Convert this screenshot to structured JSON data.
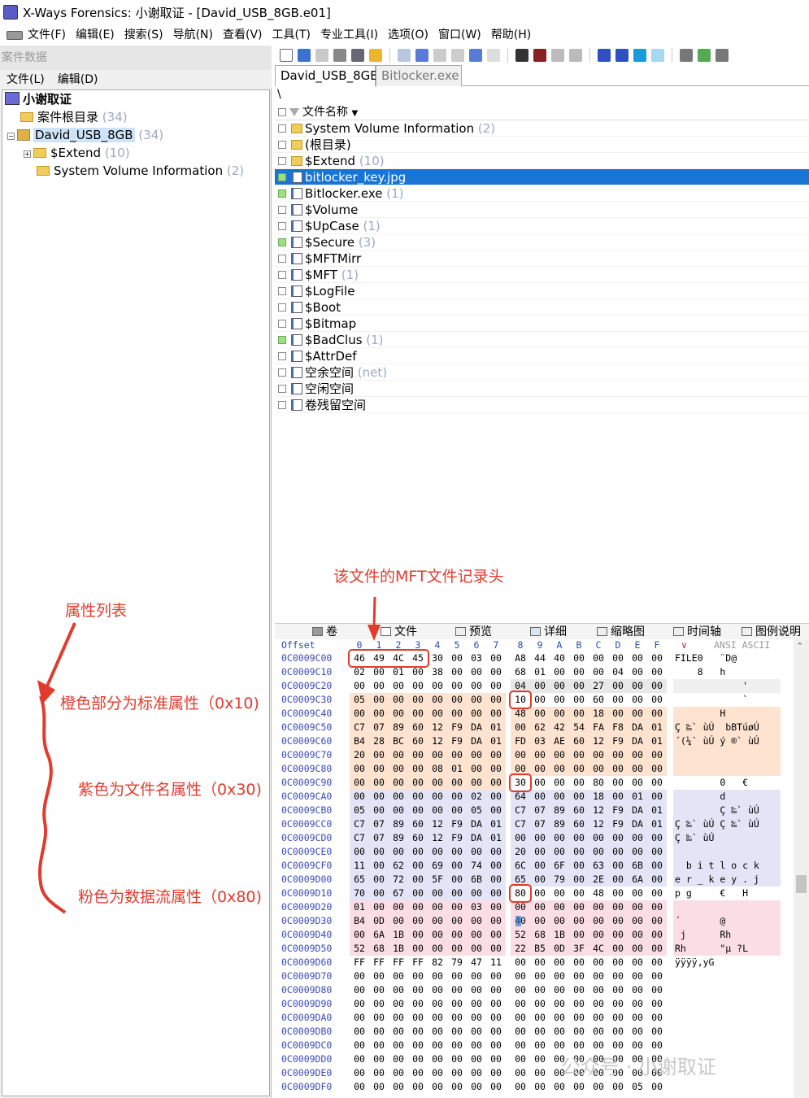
{
  "window": {
    "title": "X-Ways Forensics: 小谢取证 - [David_USB_8GB.e01]"
  },
  "menu": [
    "文件(F)",
    "编辑(E)",
    "搜索(S)",
    "导航(N)",
    "查看(V)",
    "工具(T)",
    "专业工具(I)",
    "选项(O)",
    "窗口(W)",
    "帮助(H)"
  ],
  "left": {
    "case_header": "案件数据",
    "menu": [
      "文件(L)",
      "编辑(D)"
    ],
    "tree": [
      {
        "label": "小谢取证",
        "count": ""
      },
      {
        "label": "案件根目录",
        "count": "(34)"
      },
      {
        "label": "David_USB_8GB",
        "count": "(34)"
      },
      {
        "label": "$Extend",
        "count": "(10)"
      },
      {
        "label": "System Volume Information",
        "count": "(2)"
      }
    ]
  },
  "annotations": {
    "attr_list": "属性列表",
    "orange": "橙色部分为标准属性（0x10)",
    "purple": "紫色为文件名属性（0x30)",
    "pink": "粉色为数据流属性（0x80)",
    "mft_header": "该文件的MFT文件记录头"
  },
  "tabs": [
    "David_USB_8GB",
    "Bitlocker.exe"
  ],
  "path": "\\",
  "filelist": {
    "header": "文件名称",
    "rows": [
      {
        "name": "System Volume Information",
        "count": "(2)",
        "type": "folder",
        "check": ""
      },
      {
        "name": "(根目录)",
        "count": "",
        "type": "folder",
        "check": ""
      },
      {
        "name": "$Extend",
        "count": "(10)",
        "type": "folder",
        "check": ""
      },
      {
        "name": "bitlocker_key.jpg",
        "count": "",
        "type": "file",
        "check": "green",
        "selected": true
      },
      {
        "name": "Bitlocker.exe",
        "count": "(1)",
        "type": "file",
        "check": "green"
      },
      {
        "name": "$Volume",
        "count": "",
        "type": "file",
        "check": ""
      },
      {
        "name": "$UpCase",
        "count": "(1)",
        "type": "file",
        "check": ""
      },
      {
        "name": "$Secure",
        "count": "(3)",
        "type": "file",
        "check": "green"
      },
      {
        "name": "$MFTMirr",
        "count": "",
        "type": "file",
        "check": ""
      },
      {
        "name": "$MFT",
        "count": "(1)",
        "type": "file",
        "check": ""
      },
      {
        "name": "$LogFile",
        "count": "",
        "type": "file",
        "check": ""
      },
      {
        "name": "$Boot",
        "count": "",
        "type": "file",
        "check": ""
      },
      {
        "name": "$Bitmap",
        "count": "",
        "type": "file",
        "check": ""
      },
      {
        "name": "$BadClus",
        "count": "(1)",
        "type": "file",
        "check": "green"
      },
      {
        "name": "$AttrDef",
        "count": "",
        "type": "file",
        "check": ""
      },
      {
        "name": "空余空间",
        "count": "(net)",
        "type": "file",
        "check": ""
      },
      {
        "name": "空闲空间",
        "count": "",
        "type": "file",
        "check": ""
      },
      {
        "name": "卷残留空间",
        "count": "",
        "type": "file",
        "check": ""
      }
    ]
  },
  "bottom_tabs": [
    "卷",
    "文件",
    "预览",
    "详细",
    "缩略图",
    "时间轴",
    "图例说明"
  ],
  "hex": {
    "offset_label": "Offset",
    "cols": [
      "0",
      "1",
      "2",
      "3",
      "4",
      "5",
      "6",
      "7",
      "8",
      "9",
      "A",
      "B",
      "C",
      "D",
      "E",
      "F"
    ],
    "text_header": "ANSI ASCII",
    "rows": [
      {
        "off": "0C0009C00",
        "b": "46 49 4C 45 30 00 03 00 A8 44 40 00 00 00 00 00",
        "t": "FILE0   ¨D@     ",
        "c": ""
      },
      {
        "off": "0C0009C10",
        "b": "02 00 01 00 38 00 00 00 68 01 00 00 00 04 00 00",
        "t": "    8   h       ",
        "c": ""
      },
      {
        "off": "0C0009C20",
        "b": "00 00 00 00 00 00 00 00 04 00 00 00 27 00 00 00",
        "t": "            '   ",
        "c": "mix"
      },
      {
        "off": "0C0009C30",
        "b": "05 00 00 00 00 00 00 00 10 00 00 00 60 00 00 00",
        "t": "            `   ",
        "c": "o2"
      },
      {
        "off": "0C0009C40",
        "b": "00 00 00 00 00 00 00 00 48 00 00 00 18 00 00 00",
        "t": "        H       ",
        "c": "o"
      },
      {
        "off": "0C0009C50",
        "b": "C7 07 89 60 12 F9 DA 01 00 62 42 54 FA F8 DA 01",
        "t": "Ç ‰` ùÚ  bBTúøÚ ",
        "c": "o"
      },
      {
        "off": "0C0009C60",
        "b": "B4 28 BC 60 12 F9 DA 01 FD 03 AE 60 12 F9 DA 01",
        "t": "´(¼` ùÚ ý ®` ùÚ ",
        "c": "o"
      },
      {
        "off": "0C0009C70",
        "b": "20 00 00 00 00 00 00 00 00 00 00 00 00 00 00 00",
        "t": "                ",
        "c": "o"
      },
      {
        "off": "0C0009C80",
        "b": "00 00 00 00 08 01 00 00 00 00 00 00 00 00 00 00",
        "t": "                ",
        "c": "o"
      },
      {
        "off": "0C0009C90",
        "b": "00 00 00 00 00 00 00 00 30 00 00 00 80 00 00 00",
        "t": "        0   €   ",
        "c": "o2"
      },
      {
        "off": "0C0009CA0",
        "b": "00 00 00 00 00 00 02 00 64 00 00 00 18 00 01 00",
        "t": "        d       ",
        "c": "p"
      },
      {
        "off": "0C0009CB0",
        "b": "05 00 00 00 00 00 05 00 C7 07 89 60 12 F9 DA 01",
        "t": "        Ç ‰` ùÚ ",
        "c": "p"
      },
      {
        "off": "0C0009CC0",
        "b": "C7 07 89 60 12 F9 DA 01 C7 07 89 60 12 F9 DA 01",
        "t": "Ç ‰` ùÚ Ç ‰` ùÚ ",
        "c": "p"
      },
      {
        "off": "0C0009CD0",
        "b": "C7 07 89 60 12 F9 DA 01 00 00 00 00 00 00 00 00",
        "t": "Ç ‰` ùÚ         ",
        "c": "p"
      },
      {
        "off": "0C0009CE0",
        "b": "00 00 00 00 00 00 00 00 20 00 00 00 00 00 00 00",
        "t": "                ",
        "c": "p"
      },
      {
        "off": "0C0009CF0",
        "b": "11 00 62 00 69 00 74 00 6C 00 6F 00 63 00 6B 00",
        "t": "  b i t l o c k ",
        "c": "p"
      },
      {
        "off": "0C0009D00",
        "b": "65 00 72 00 5F 00 6B 00 65 00 79 00 2E 00 6A 00",
        "t": "e r _ k e y . j ",
        "c": "p"
      },
      {
        "off": "0C0009D10",
        "b": "70 00 67 00 00 00 00 00 80 00 00 00 48 00 00 00",
        "t": "p g     €   H   ",
        "c": "p2"
      },
      {
        "off": "0C0009D20",
        "b": "01 00 00 00 00 00 03 00 00 00 00 00 00 00 00 00",
        "t": "                ",
        "c": "k"
      },
      {
        "off": "0C0009D30",
        "b": "B4 0D 00 00 00 00 00 00 40 00 00 00 00 00 00 00",
        "t": "´       @       ",
        "c": "k"
      },
      {
        "off": "0C0009D40",
        "b": "00 6A 1B 00 00 00 00 00 52 68 1B 00 00 00 00 00",
        "t": " j      Rh      ",
        "c": "k"
      },
      {
        "off": "0C0009D50",
        "b": "52 68 1B 00 00 00 00 00 22 B5 0D 3F 4C 00 00 00",
        "t": "Rh      \"µ ?L   ",
        "c": "k"
      },
      {
        "off": "0C0009D60",
        "b": "FF FF FF FF 82 79 47 11 00 00 00 00 00 00 00 00",
        "t": "ÿÿÿÿ‚yG         ",
        "c": ""
      },
      {
        "off": "0C0009D70",
        "b": "00 00 00 00 00 00 00 00 00 00 00 00 00 00 00 00",
        "t": "",
        "c": ""
      },
      {
        "off": "0C0009D80",
        "b": "00 00 00 00 00 00 00 00 00 00 00 00 00 00 00 00",
        "t": "",
        "c": ""
      },
      {
        "off": "0C0009D90",
        "b": "00 00 00 00 00 00 00 00 00 00 00 00 00 00 00 00",
        "t": "",
        "c": ""
      },
      {
        "off": "0C0009DA0",
        "b": "00 00 00 00 00 00 00 00 00 00 00 00 00 00 00 00",
        "t": "",
        "c": ""
      },
      {
        "off": "0C0009DB0",
        "b": "00 00 00 00 00 00 00 00 00 00 00 00 00 00 00 00",
        "t": "",
        "c": ""
      },
      {
        "off": "0C0009DC0",
        "b": "00 00 00 00 00 00 00 00 00 00 00 00 00 00 00 00",
        "t": "",
        "c": ""
      },
      {
        "off": "0C0009DD0",
        "b": "00 00 00 00 00 00 00 00 00 00 00 00 00 00 00 00",
        "t": "",
        "c": ""
      },
      {
        "off": "0C0009DE0",
        "b": "00 00 00 00 00 00 00 00 00 00 00 00 00 00 00 00",
        "t": "",
        "c": ""
      },
      {
        "off": "0C0009DF0",
        "b": "00 00 00 00 00 00 00 00 00 00 00 00 00 00 05 00",
        "t": "",
        "c": ""
      }
    ]
  },
  "watermark": "公众号 · 小谢取证",
  "colors": {
    "selected": "#1874d5",
    "orange": "#fde3d0",
    "purple": "#e3e5f7",
    "pink": "#fbdde6",
    "annotation": "#e23b2e",
    "offset": "#3a4ab8"
  }
}
